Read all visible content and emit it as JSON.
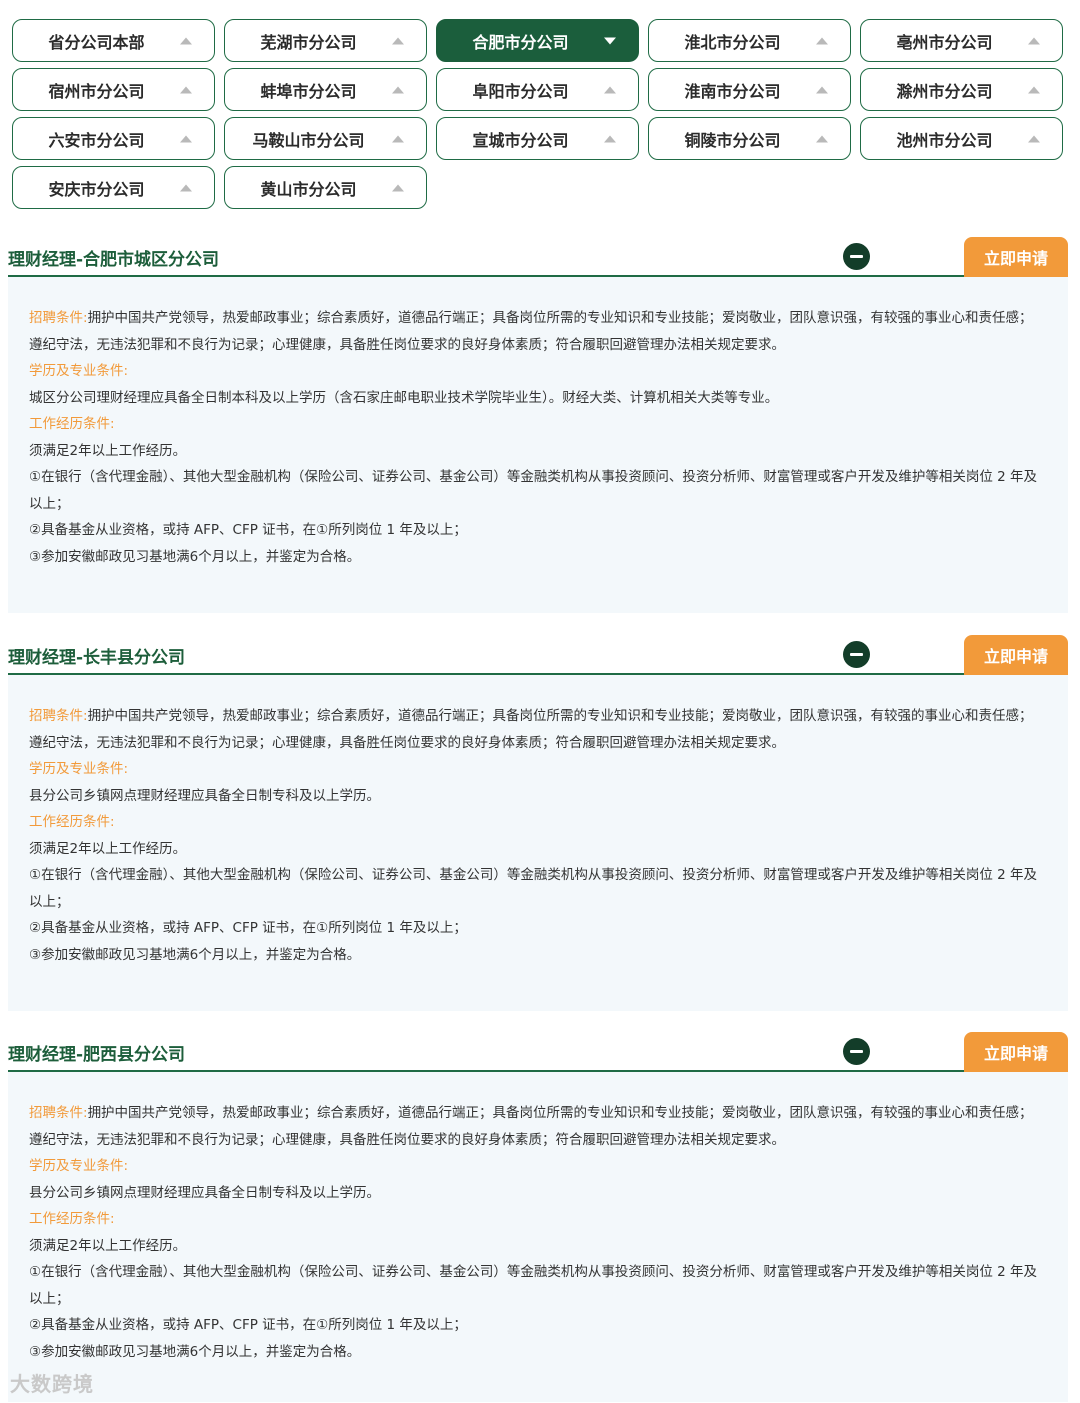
{
  "tabs": [
    {
      "label": "省分公司本部",
      "active": false
    },
    {
      "label": "芜湖市分公司",
      "active": false
    },
    {
      "label": "合肥市分公司",
      "active": true
    },
    {
      "label": "淮北市分公司",
      "active": false
    },
    {
      "label": "亳州市分公司",
      "active": false
    },
    {
      "label": "宿州市分公司",
      "active": false
    },
    {
      "label": "蚌埠市分公司",
      "active": false
    },
    {
      "label": "阜阳市分公司",
      "active": false
    },
    {
      "label": "淮南市分公司",
      "active": false
    },
    {
      "label": "滁州市分公司",
      "active": false
    },
    {
      "label": "六安市分公司",
      "active": false
    },
    {
      "label": "马鞍山市分公司",
      "active": false
    },
    {
      "label": "宣城市分公司",
      "active": false
    },
    {
      "label": "铜陵市分公司",
      "active": false
    },
    {
      "label": "池州市分公司",
      "active": false
    },
    {
      "label": "安庆市分公司",
      "active": false
    },
    {
      "label": "黄山市分公司",
      "active": false
    }
  ],
  "sections": [
    {
      "title": "理财经理-合肥市城区分公司",
      "apply_label": "立即申请",
      "recruit_label": "招聘条件:",
      "recruit_text": "拥护中国共产党领导，热爱邮政事业；综合素质好，道德品行端正；具备岗位所需的专业知识和专业技能；爱岗敬业，团队意识强，有较强的事业心和责任感；遵纪守法，无违法犯罪和不良行为记录；心理健康，具备胜任岗位要求的良好身体素质；符合履职回避管理办法相关规定要求。",
      "edu_label": "学历及专业条件:",
      "edu_text": "城区分公司理财经理应具备全日制本科及以上学历（含石家庄邮电职业技术学院毕业生）。财经大类、计算机相关大类等专业。",
      "work_label": "工作经历条件:",
      "work_lines": [
        "须满足2年以上工作经历。",
        "①在银行（含代理金融）、其他大型金融机构（保险公司、证券公司、基金公司）等金融类机构从事投资顾问、投资分析师、财富管理或客户开发及维护等相关岗位 2 年及以上；",
        "②具备基金从业资格，或持 AFP、CFP 证书，在①所列岗位 1 年及以上；",
        "③参加安徽邮政见习基地满6个月以上，并鉴定为合格。"
      ]
    },
    {
      "title": "理财经理-长丰县分公司",
      "apply_label": "立即申请",
      "recruit_label": "招聘条件:",
      "recruit_text": "拥护中国共产党领导，热爱邮政事业；综合素质好，道德品行端正；具备岗位所需的专业知识和专业技能；爱岗敬业，团队意识强，有较强的事业心和责任感；遵纪守法，无违法犯罪和不良行为记录；心理健康，具备胜任岗位要求的良好身体素质；符合履职回避管理办法相关规定要求。",
      "edu_label": "学历及专业条件:",
      "edu_text": "县分公司乡镇网点理财经理应具备全日制专科及以上学历。",
      "work_label": "工作经历条件:",
      "work_lines": [
        "须满足2年以上工作经历。",
        "①在银行（含代理金融）、其他大型金融机构（保险公司、证券公司、基金公司）等金融类机构从事投资顾问、投资分析师、财富管理或客户开发及维护等相关岗位 2 年及以上；",
        "②具备基金从业资格，或持 AFP、CFP 证书，在①所列岗位 1 年及以上；",
        "③参加安徽邮政见习基地满6个月以上，并鉴定为合格。"
      ]
    },
    {
      "title": "理财经理-肥西县分公司",
      "apply_label": "立即申请",
      "recruit_label": "招聘条件:",
      "recruit_text": "拥护中国共产党领导，热爱邮政事业；综合素质好，道德品行端正；具备岗位所需的专业知识和专业技能；爱岗敬业，团队意识强，有较强的事业心和责任感；遵纪守法，无违法犯罪和不良行为记录；心理健康，具备胜任岗位要求的良好身体素质；符合履职回避管理办法相关规定要求。",
      "edu_label": "学历及专业条件:",
      "edu_text": "县分公司乡镇网点理财经理应具备全日制专科及以上学历。",
      "work_label": "工作经历条件:",
      "work_lines": [
        "须满足2年以上工作经历。",
        "①在银行（含代理金融）、其他大型金融机构（保险公司、证券公司、基金公司）等金融类机构从事投资顾问、投资分析师、财富管理或客户开发及维护等相关岗位 2 年及以上；",
        "②具备基金从业资格，或持 AFP、CFP 证书，在①所列岗位 1 年及以上；",
        "③参加安徽邮政见习基地满6个月以上，并鉴定为合格。"
      ]
    }
  ],
  "watermark": "大数跨境",
  "colors": {
    "brand_green": "#1b5e3c",
    "accent_orange": "#f29a3a",
    "panel_bg": "#f3f8fb"
  }
}
